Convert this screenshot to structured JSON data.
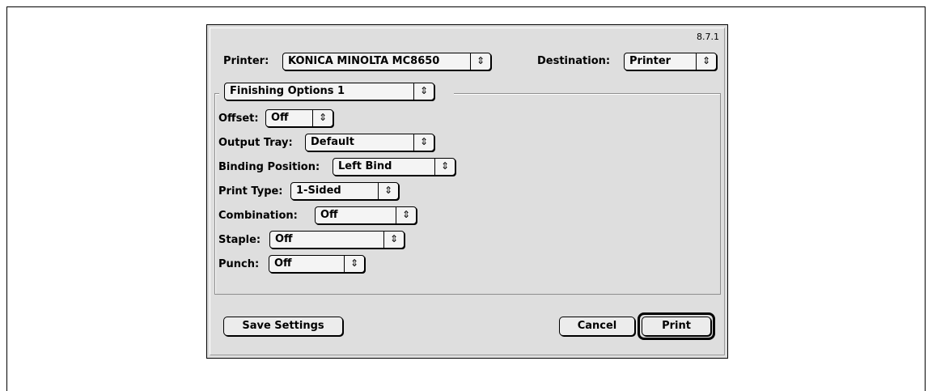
{
  "dialog": {
    "version": "8.7.1",
    "printer_label": "Printer:",
    "printer_value": "KONICA MINOLTA MC8650",
    "destination_label": "Destination:",
    "destination_value": "Printer",
    "panel_value": "Finishing Options 1",
    "options": [
      {
        "label": "Offset:",
        "value": "Off"
      },
      {
        "label": "Output Tray:",
        "value": "Default"
      },
      {
        "label": "Binding Position:",
        "value": "Left Bind"
      },
      {
        "label": "Print Type:",
        "value": "1-Sided"
      },
      {
        "label": "Combination:",
        "value": "Off"
      },
      {
        "label": "Staple:",
        "value": "Off"
      },
      {
        "label": "Punch:",
        "value": "Off"
      }
    ],
    "save_settings_label": "Save Settings",
    "cancel_label": "Cancel",
    "print_label": "Print"
  },
  "icons": {
    "popup_arrows": "up-down-arrows-icon"
  }
}
